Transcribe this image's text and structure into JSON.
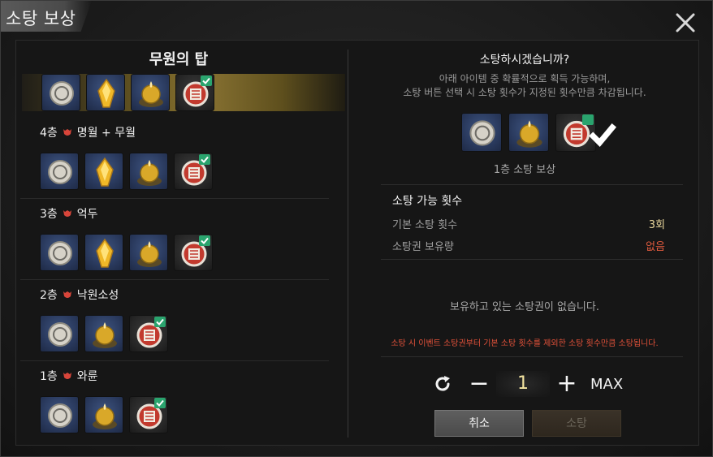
{
  "window": {
    "title": "소탕 보상",
    "close_icon": "close-x-icon"
  },
  "left": {
    "title": "무원의 탑",
    "top_row_items": [
      "coin",
      "gold-crystal",
      "gold-orb",
      "sweep-ticket"
    ],
    "floors": [
      {
        "label": "4층",
        "boss": "명월 + 무월",
        "items": [
          "coin",
          "gold-crystal",
          "gold-orb",
          "sweep-ticket"
        ]
      },
      {
        "label": "3층",
        "boss": "억두",
        "items": [
          "coin",
          "gold-crystal",
          "gold-orb",
          "sweep-ticket"
        ]
      },
      {
        "label": "2층",
        "boss": "낙원소성",
        "items": [
          "coin",
          "gold-orb",
          "sweep-ticket"
        ]
      },
      {
        "label": "1층",
        "boss": "와륜",
        "items": [
          "coin",
          "gold-orb",
          "sweep-ticket"
        ]
      }
    ]
  },
  "right": {
    "question": "소탕하시겠습니까?",
    "desc_line1": "아래 아이템 중 확률적으로 획득 가능하며,",
    "desc_line2": "소탕 버튼 선택 시 소탕 횟수가 지정된 횟수만큼 차감됩니다.",
    "reward_items": [
      "coin",
      "gold-orb",
      "sweep-ticket"
    ],
    "reward_label": "1층 소탕 보상",
    "count_title": "소탕 가능 횟수",
    "basic_label": "기본 소탕 횟수",
    "basic_value": "3회",
    "owned_label": "소탕권 보유량",
    "owned_value": "없음",
    "no_ticket": "보유하고 있는 소탕권이 없습니다.",
    "warning": "소탕 시 이벤트 소탕권부터 기본 소탕 횟수를 제외한 소탕 횟수만큼 소탕됩니다.",
    "quantity": "1",
    "minus": "−",
    "plus": "+",
    "max": "MAX",
    "cancel": "취소",
    "sweep": "소탕"
  },
  "colors": {
    "accent_gold": "#8a7433",
    "warn_red": "#e4523a",
    "check_green": "#2aa46e"
  }
}
